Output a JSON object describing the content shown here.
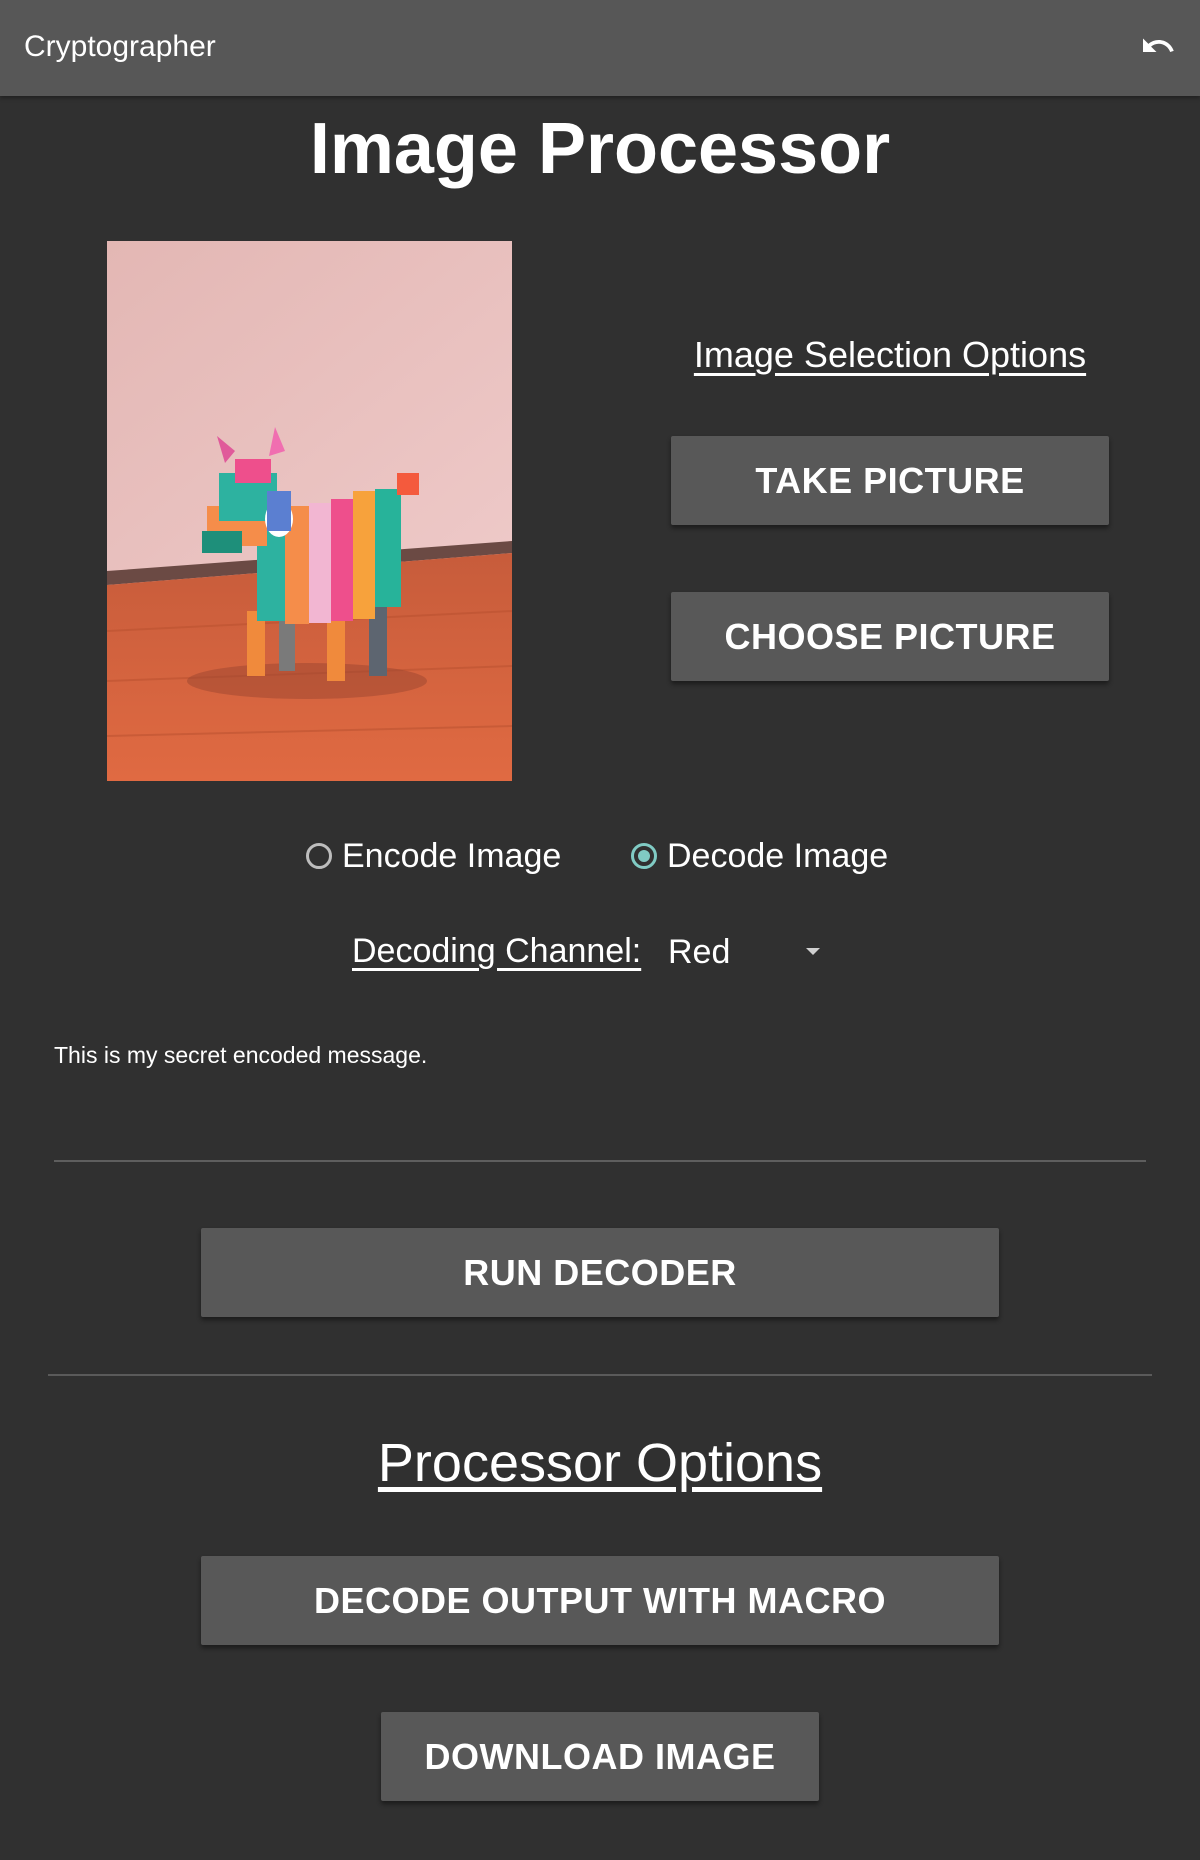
{
  "appbar": {
    "title": "Cryptographer",
    "undo_icon": "undo-icon"
  },
  "page": {
    "title": "Image Processor"
  },
  "image_selection": {
    "heading": "Image Selection Options",
    "take_picture_label": "TAKE PICTURE",
    "choose_picture_label": "CHOOSE PICTURE"
  },
  "mode": {
    "encode_label": "Encode Image",
    "decode_label": "Decode Image",
    "selected": "decode"
  },
  "channel": {
    "label": "Decoding Channel:",
    "value": "Red"
  },
  "message": {
    "value": "This is my secret encoded message."
  },
  "run_label": "RUN DECODER",
  "processor_options": {
    "heading": "Processor Options",
    "macro_label": "DECODE OUTPUT WITH MACRO",
    "download_label": "DOWNLOAD IMAGE"
  },
  "colors": {
    "background": "#303030",
    "appbar": "#575757",
    "button": "#585858",
    "radio_accent": "#80cbc4"
  }
}
